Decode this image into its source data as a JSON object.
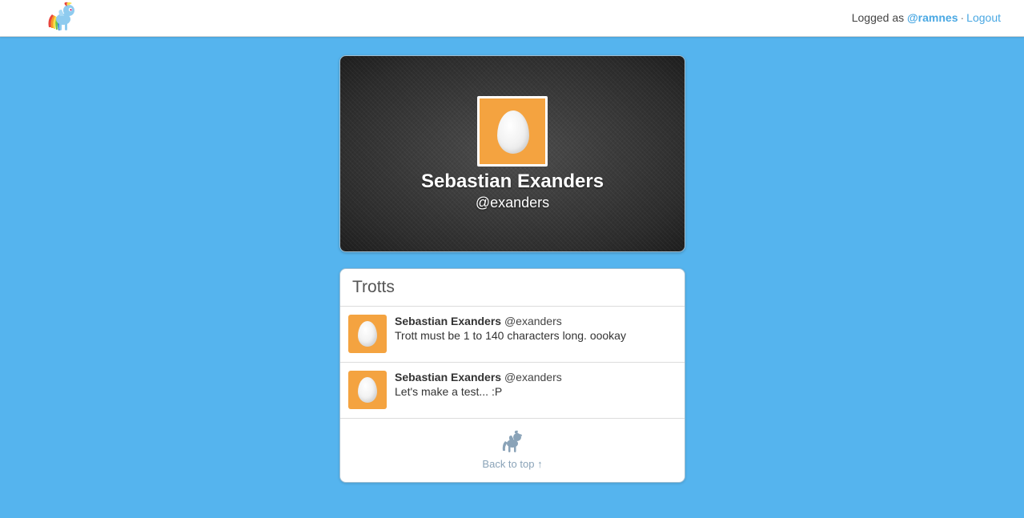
{
  "topbar": {
    "logo_icon": "pony-logo-icon",
    "session_prefix": "Logged as ",
    "username": "@ramnes",
    "separator": "·",
    "logout_label": "Logout"
  },
  "profile": {
    "name": "Sebastian Exanders",
    "handle": "@exanders",
    "avatar_icon": "egg-avatar-icon",
    "avatar_color": "#f4a340"
  },
  "trotts_panel": {
    "title": "Trotts",
    "items": [
      {
        "author_name": "Sebastian Exanders",
        "author_handle": "@exanders",
        "text": "Trott must be 1 to 140 characters long. oookay"
      },
      {
        "author_name": "Sebastian Exanders",
        "author_handle": "@exanders",
        "text": "Let's make a test... :P"
      }
    ],
    "footer": {
      "icon": "pony-silhouette-icon",
      "back_to_top_label": "Back to top ↑"
    }
  },
  "colors": {
    "background": "#55b4ee",
    "accent_link": "#4aa8e3",
    "avatar_orange": "#f4a340"
  }
}
